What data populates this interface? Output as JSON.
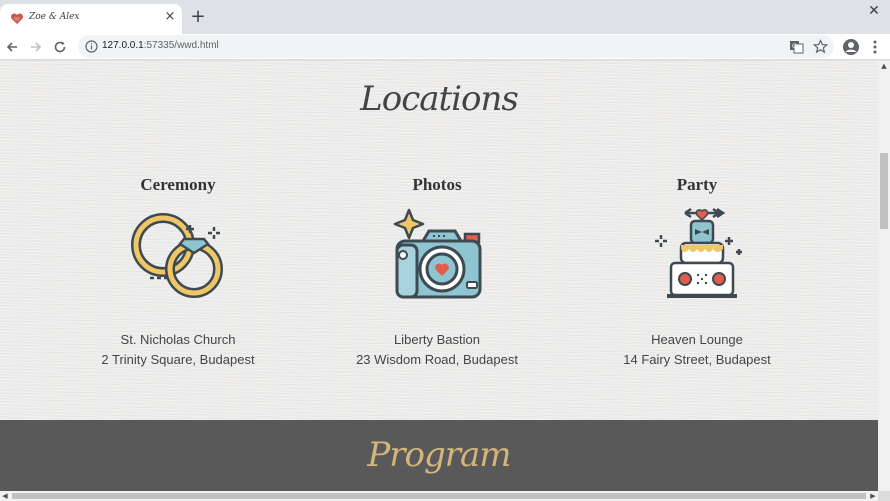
{
  "browser": {
    "tab_title": "Zoe & Alex",
    "tab_close": "×",
    "new_tab": "+",
    "window_close": "✕",
    "url_host": "127.0.0.1",
    "url_rest": ":57335/wwd.html"
  },
  "page": {
    "locations_title": "Locations",
    "columns": [
      {
        "heading": "Ceremony",
        "icon": "wedding-rings-icon",
        "place": "St. Nicholas Church",
        "address": "2 Trinity Square, Budapest"
      },
      {
        "heading": "Photos",
        "icon": "camera-icon",
        "place": "Liberty Bastion",
        "address": "23 Wisdom Road, Budapest"
      },
      {
        "heading": "Party",
        "icon": "wedding-cake-icon",
        "place": "Heaven Lounge",
        "address": "14 Fairy Street, Budapest"
      }
    ],
    "program_title": "Program"
  },
  "colors": {
    "gold": "#d4b57a",
    "dark": "#3d4a52",
    "blue": "#8ec5d1",
    "red": "#e25d4c",
    "ring_gold": "#f0c766"
  }
}
